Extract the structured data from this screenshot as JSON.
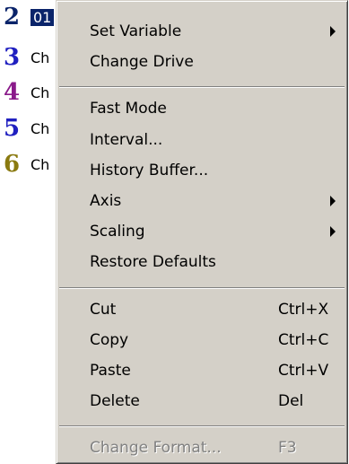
{
  "channels": [
    {
      "number": "2",
      "text": "01",
      "color": "#0a246a",
      "selected": true
    },
    {
      "number": "3",
      "text": "Ch",
      "color": "#2020c0",
      "selected": false
    },
    {
      "number": "4",
      "text": "Ch",
      "color": "#8a1a8a",
      "selected": false
    },
    {
      "number": "5",
      "text": "Ch",
      "color": "#2020c0",
      "selected": false
    },
    {
      "number": "6",
      "text": "Ch",
      "color": "#8a7a10",
      "selected": false
    }
  ],
  "menu": {
    "groups": [
      [
        {
          "label": "Set Variable",
          "submenu": true
        },
        {
          "label": "Change Drive"
        }
      ],
      [
        {
          "label": "Fast Mode"
        },
        {
          "label": "Interval..."
        },
        {
          "label": "History Buffer..."
        },
        {
          "label": "Axis",
          "submenu": true
        },
        {
          "label": "Scaling",
          "submenu": true
        },
        {
          "label": "Restore Defaults"
        }
      ],
      [
        {
          "label": "Cut",
          "shortcut": "Ctrl+X"
        },
        {
          "label": "Copy",
          "shortcut": "Ctrl+C"
        },
        {
          "label": "Paste",
          "shortcut": "Ctrl+V"
        },
        {
          "label": "Delete",
          "shortcut": "Del"
        }
      ],
      [
        {
          "label": "Change Format...",
          "shortcut": "F3",
          "disabled": true
        }
      ]
    ]
  }
}
